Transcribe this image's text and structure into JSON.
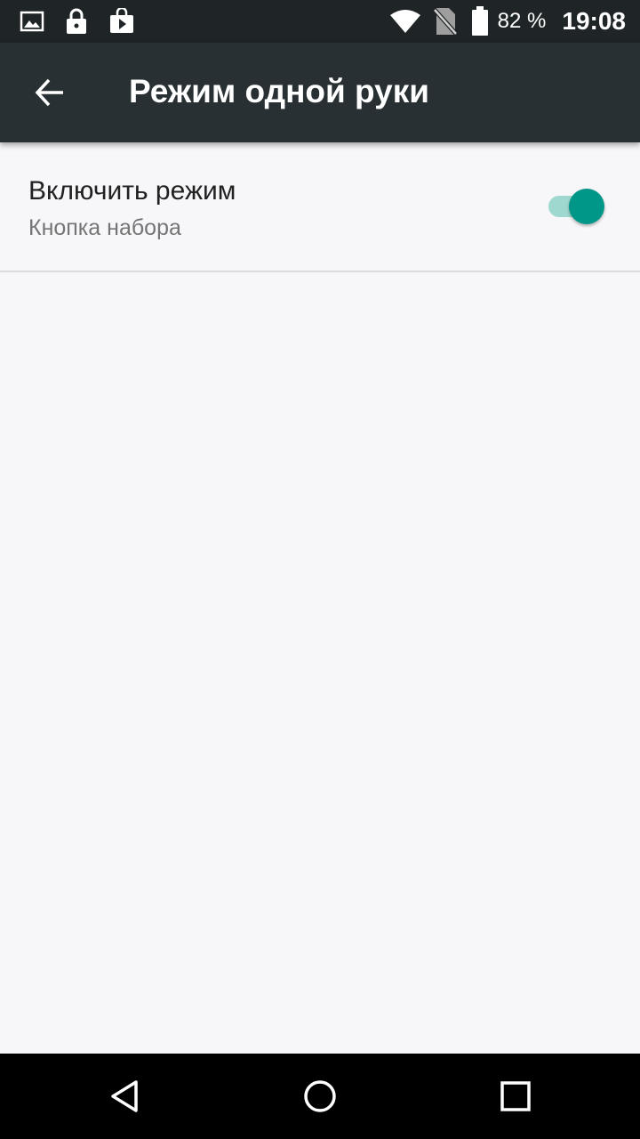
{
  "status_bar": {
    "icons_left": [
      "gallery-icon",
      "lock-icon",
      "play-store-icon"
    ],
    "icons_right": [
      "wifi-icon",
      "no-sim-icon",
      "battery-icon"
    ],
    "battery_percent": "82 %",
    "time": "19:08"
  },
  "toolbar": {
    "back_icon": "arrow-back-icon",
    "title": "Режим одной руки",
    "background_color": "#283033"
  },
  "settings": {
    "enable_mode": {
      "title": "Включить режим",
      "summary": "Кнопка набора",
      "checked": true,
      "accent_color": "#009688"
    }
  },
  "nav_bar": {
    "buttons": [
      "back-triangle-icon",
      "home-circle-icon",
      "recents-square-icon"
    ]
  }
}
